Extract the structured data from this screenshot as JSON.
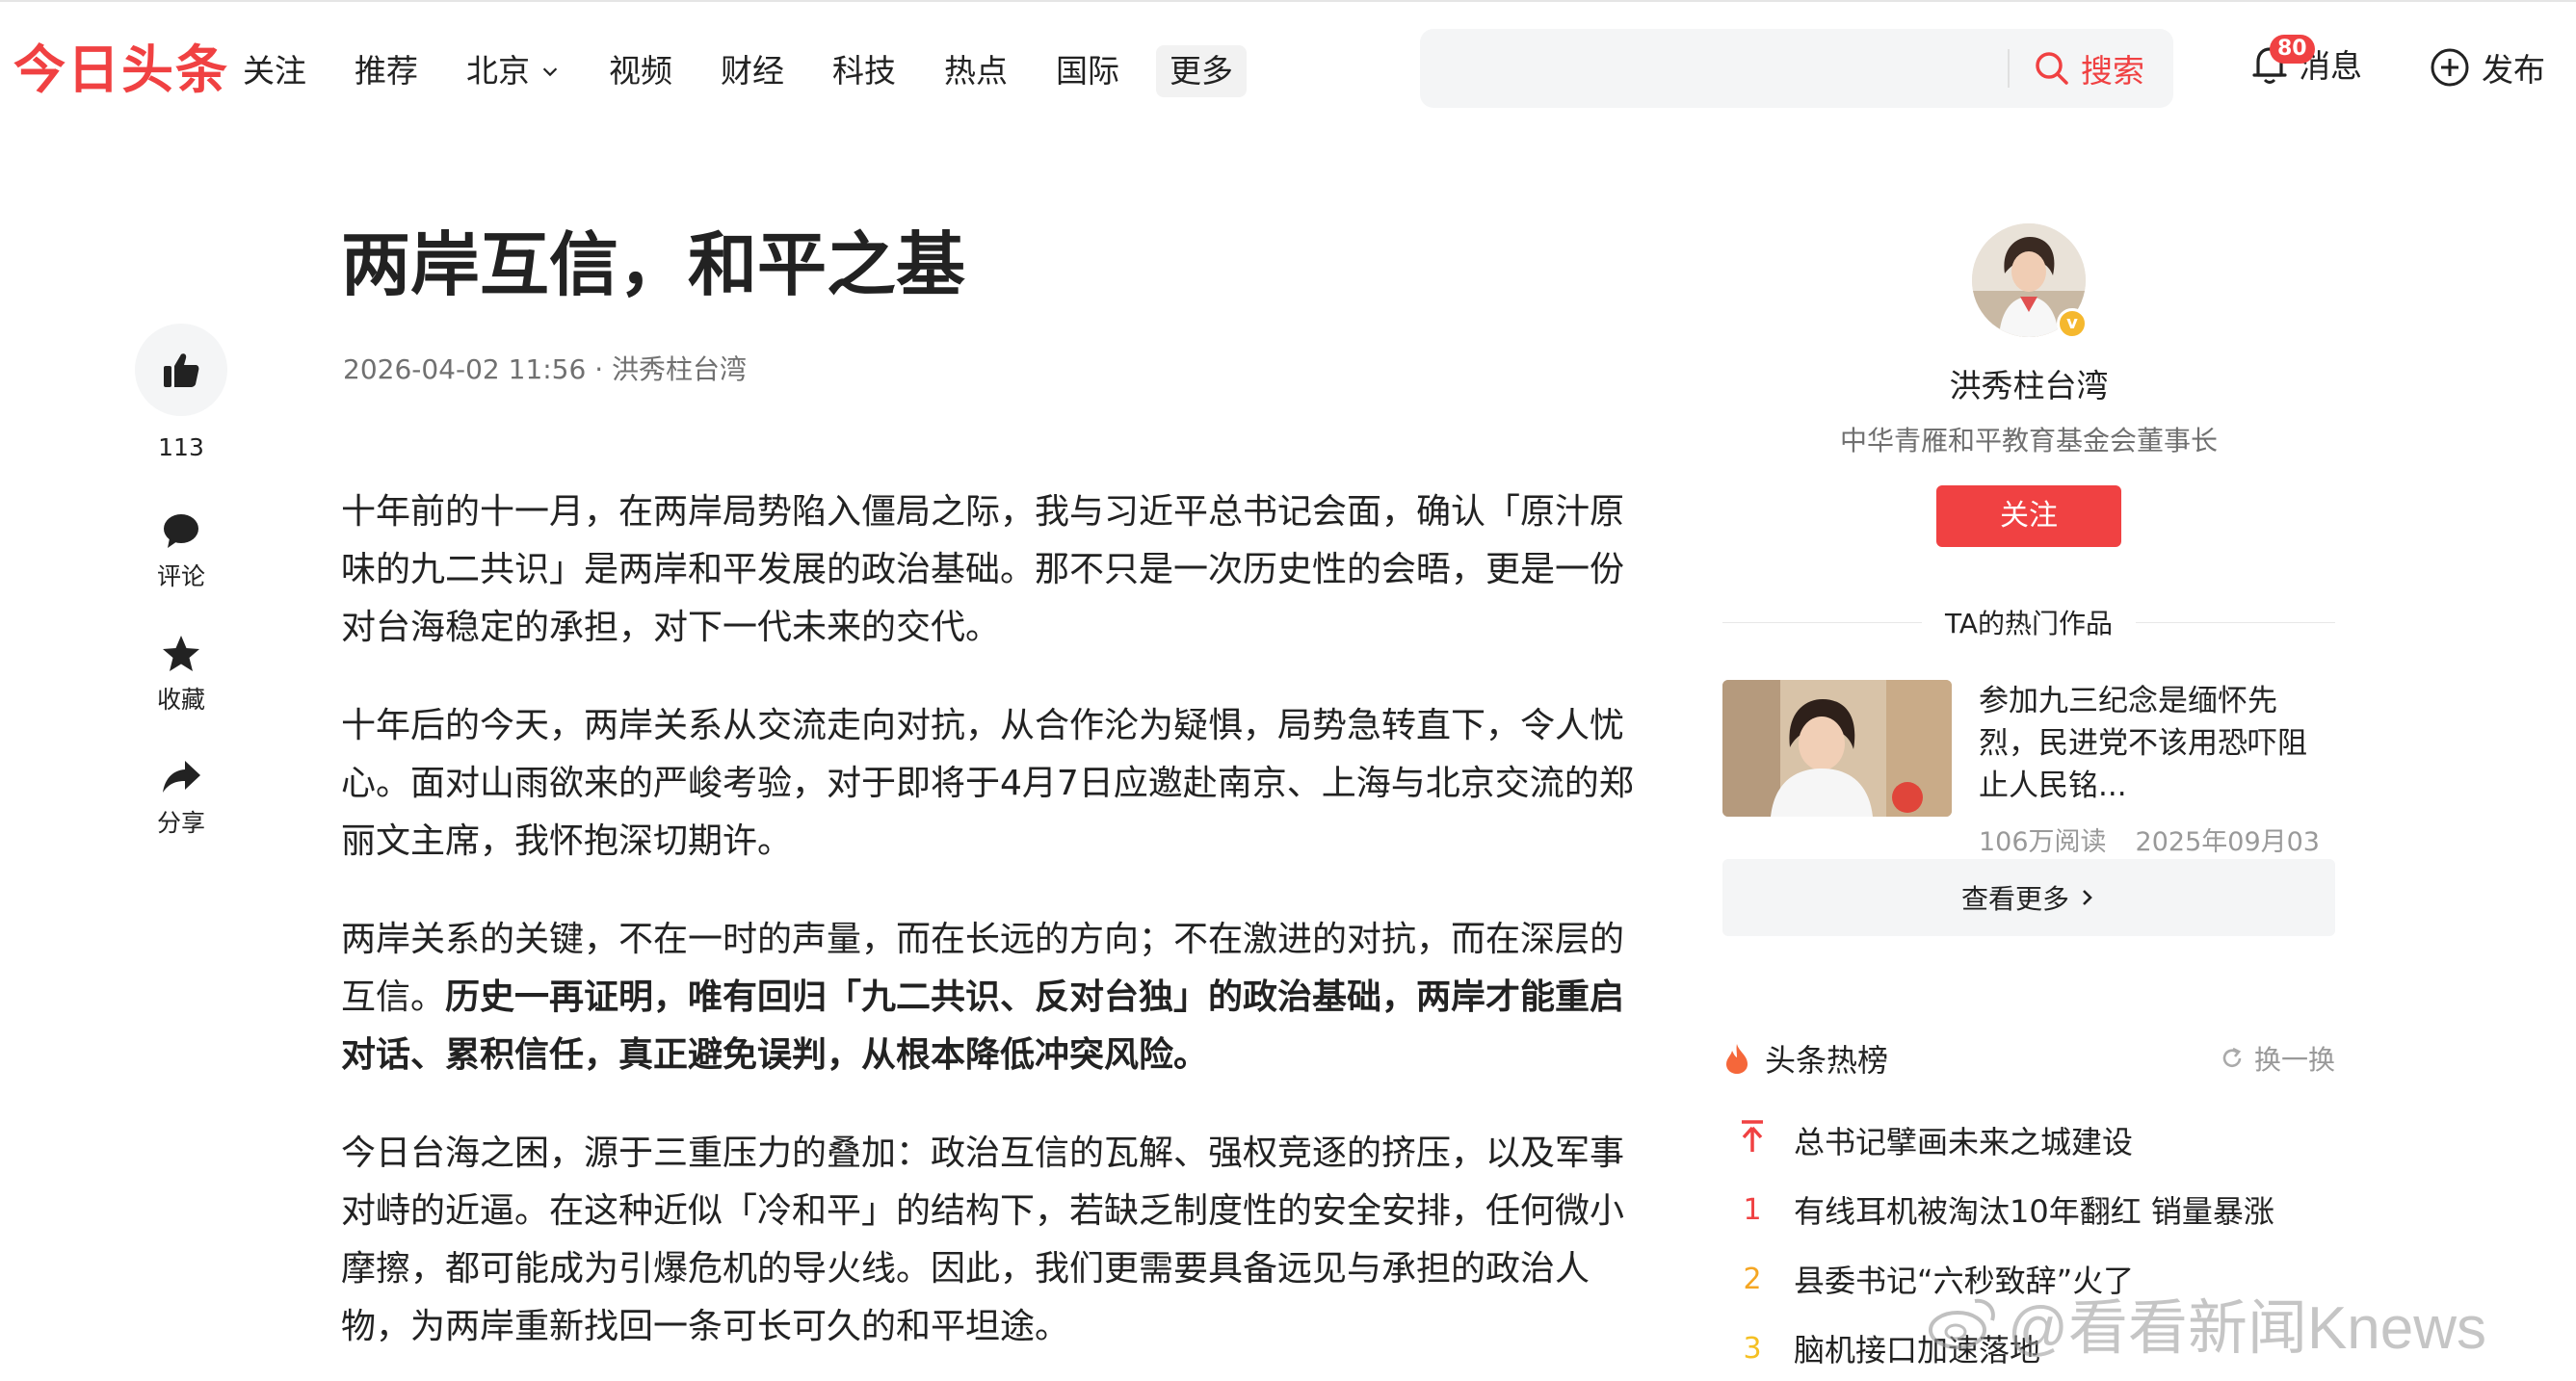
{
  "header": {
    "logo": "今日头条",
    "nav": [
      "关注",
      "推荐",
      "北京",
      "视频",
      "财经",
      "科技",
      "热点",
      "国际"
    ],
    "nav_more": "更多",
    "search_placeholder": "",
    "search_label": "搜索",
    "message_label": "消息",
    "message_badge": "80",
    "publish_label": "发布"
  },
  "rail": {
    "like_count": "113",
    "comment_label": "评论",
    "favorite_label": "收藏",
    "share_label": "分享"
  },
  "article": {
    "title": "两岸互信，和平之基",
    "meta": "2026-04-02 11:56 · 洪秀柱台湾",
    "p1": "十年前的十一月，在两岸局势陷入僵局之际，我与习近平总书记会面，确认「原汁原味的九二共识」是两岸和平发展的政治基础。那不只是一次历史性的会晤，更是一份对台海稳定的承担，对下一代未来的交代。",
    "p2": "十年后的今天，两岸关系从交流走向对抗，从合作沦为疑惧，局势急转直下，令人忧心。面对山雨欲来的严峻考验，对于即将于4月7日应邀赴南京、上海与北京交流的郑丽文主席，我怀抱深切期许。",
    "p3_normal": "两岸关系的关键，不在一时的声量，而在长远的方向；不在激进的对抗，而在深层的互信。",
    "p3_bold": "历史一再证明，唯有回归「九二共识、反对台独」的政治基础，两岸才能重启对话、累积信任，真正避免误判，从根本降低冲突风险。",
    "p4": "今日台海之困，源于三重压力的叠加：政治互信的瓦解、强权竞逐的挤压，以及军事对峙的近逼。在这种近似「冷和平」的结构下，若缺乏制度性的安全安排，任何微小摩擦，都可能成为引爆危机的导火线。因此，我们更需要具备远见与承担的政治人物，为两岸重新找回一条可长可久的和平坦途。"
  },
  "author": {
    "name": "洪秀柱台湾",
    "desc": "中华青雁和平教育基金会董事长",
    "follow_label": "关注"
  },
  "hot_works": {
    "title": "TA的热门作品",
    "item_title": "参加九三纪念是缅怀先烈，民进党不该用恐吓阻止人民铭...",
    "item_reads": "106万阅读",
    "item_date": "2025年09月03日",
    "see_more": "查看更多"
  },
  "hot_board": {
    "title": "头条热榜",
    "refresh_label": "换一换",
    "items": [
      {
        "rank": "",
        "text": "总书记擘画未来之城建设",
        "color": "#f04142"
      },
      {
        "rank": "1",
        "text": "有线耳机被淘汰10年翻红 销量暴涨",
        "color": "#f04142"
      },
      {
        "rank": "2",
        "text": "县委书记“六秒致辞”火了",
        "color": "#f5a623"
      },
      {
        "rank": "3",
        "text": "脑机接口加速落地",
        "color": "#f5c023"
      }
    ]
  },
  "watermark": "@看看新闻Knews"
}
